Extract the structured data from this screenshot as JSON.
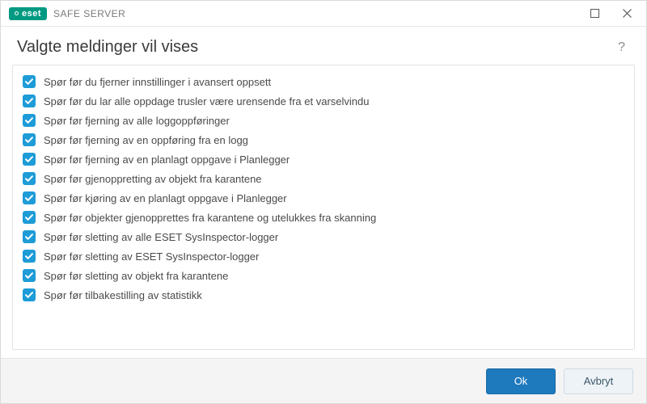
{
  "titlebar": {
    "brand": "eset",
    "product": "SAFE SERVER"
  },
  "header": {
    "title": "Valgte meldinger vil vises",
    "help": "?"
  },
  "list": {
    "items": [
      {
        "label": "Spør før du fjerner innstillinger i avansert oppsett",
        "checked": true
      },
      {
        "label": "Spør før du lar alle oppdage trusler være urensende fra et varselvindu",
        "checked": true
      },
      {
        "label": "Spør før fjerning av alle loggoppføringer",
        "checked": true
      },
      {
        "label": "Spør før fjerning av en oppføring fra en logg",
        "checked": true
      },
      {
        "label": "Spør før fjerning av en planlagt oppgave i Planlegger",
        "checked": true
      },
      {
        "label": "Spør før gjenoppretting av objekt fra karantene",
        "checked": true
      },
      {
        "label": "Spør før kjøring av en planlagt oppgave i Planlegger",
        "checked": true
      },
      {
        "label": "Spør før objekter gjenopprettes fra karantene og utelukkes fra skanning",
        "checked": true
      },
      {
        "label": "Spør før sletting av alle ESET SysInspector-logger",
        "checked": true
      },
      {
        "label": "Spør før sletting av ESET SysInspector-logger",
        "checked": true
      },
      {
        "label": "Spør før sletting av objekt fra karantene",
        "checked": true
      },
      {
        "label": "Spør før tilbakestilling av statistikk",
        "checked": true
      }
    ]
  },
  "footer": {
    "ok": "Ok",
    "cancel": "Avbryt"
  },
  "colors": {
    "brand": "#009982",
    "checkbox": "#1e9cd7",
    "primary": "#1e79bd"
  }
}
